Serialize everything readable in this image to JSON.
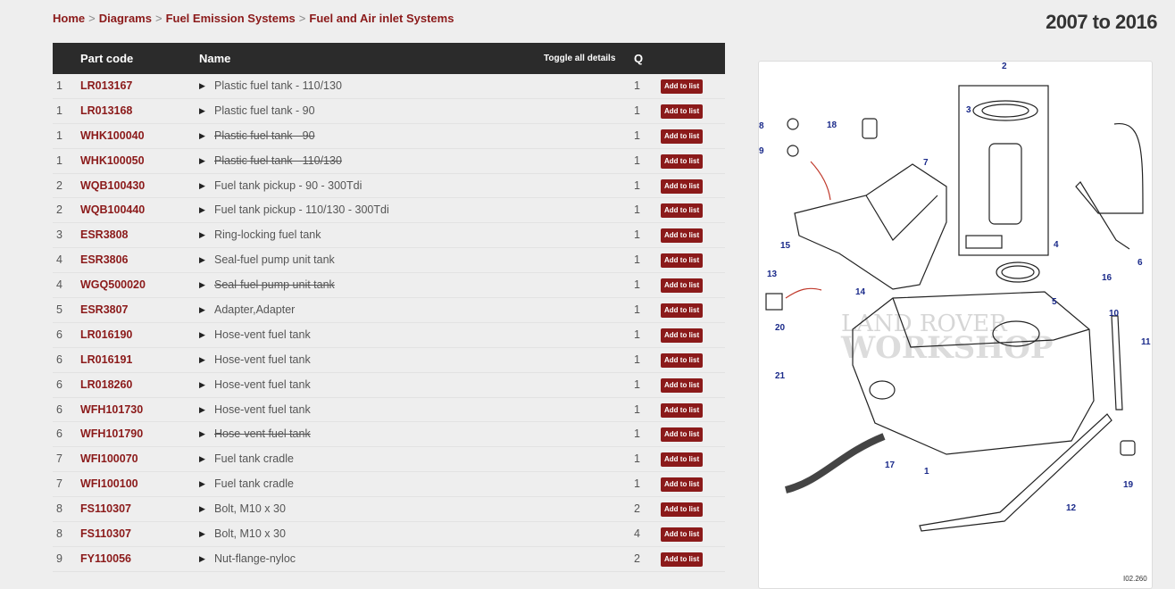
{
  "breadcrumb": [
    "Home",
    "Diagrams",
    "Fuel Emission Systems",
    "Fuel and Air inlet Systems"
  ],
  "year_range": "2007 to 2016",
  "table": {
    "headers": {
      "part_code": "Part code",
      "name": "Name",
      "toggle": "Toggle all details",
      "q": "Q"
    },
    "add_label": "Add to list",
    "rows": [
      {
        "num": "1",
        "code": "LR013167",
        "name": "Plastic fuel tank - 110/130",
        "q": "1",
        "struck": false
      },
      {
        "num": "1",
        "code": "LR013168",
        "name": "Plastic fuel tank - 90",
        "q": "1",
        "struck": false
      },
      {
        "num": "1",
        "code": "WHK100040",
        "name": "Plastic fuel tank - 90",
        "q": "1",
        "struck": true
      },
      {
        "num": "1",
        "code": "WHK100050",
        "name": "Plastic fuel tank - 110/130",
        "q": "1",
        "struck": true
      },
      {
        "num": "2",
        "code": "WQB100430",
        "name": "Fuel tank pickup - 90 - 300Tdi",
        "q": "1",
        "struck": false
      },
      {
        "num": "2",
        "code": "WQB100440",
        "name": "Fuel tank pickup - 110/130 - 300Tdi",
        "q": "1",
        "struck": false
      },
      {
        "num": "3",
        "code": "ESR3808",
        "name": "Ring-locking fuel tank",
        "q": "1",
        "struck": false
      },
      {
        "num": "4",
        "code": "ESR3806",
        "name": "Seal-fuel pump unit tank",
        "q": "1",
        "struck": false
      },
      {
        "num": "4",
        "code": "WGQ500020",
        "name": "Seal-fuel pump unit tank",
        "q": "1",
        "struck": true
      },
      {
        "num": "5",
        "code": "ESR3807",
        "name": "Adapter,Adapter",
        "q": "1",
        "struck": false
      },
      {
        "num": "6",
        "code": "LR016190",
        "name": "Hose-vent fuel tank",
        "q": "1",
        "struck": false
      },
      {
        "num": "6",
        "code": "LR016191",
        "name": "Hose-vent fuel tank",
        "q": "1",
        "struck": false
      },
      {
        "num": "6",
        "code": "LR018260",
        "name": "Hose-vent fuel tank",
        "q": "1",
        "struck": false
      },
      {
        "num": "6",
        "code": "WFH101730",
        "name": "Hose-vent fuel tank",
        "q": "1",
        "struck": false
      },
      {
        "num": "6",
        "code": "WFH101790",
        "name": "Hose-vent fuel tank",
        "q": "1",
        "struck": true
      },
      {
        "num": "7",
        "code": "WFI100070",
        "name": "Fuel tank cradle",
        "q": "1",
        "struck": false
      },
      {
        "num": "7",
        "code": "WFI100100",
        "name": "Fuel tank cradle",
        "q": "1",
        "struck": false
      },
      {
        "num": "8",
        "code": "FS110307",
        "name": "Bolt, M10 x 30",
        "q": "2",
        "struck": false
      },
      {
        "num": "8",
        "code": "FS110307",
        "name": "Bolt, M10 x 30",
        "q": "4",
        "struck": false
      },
      {
        "num": "9",
        "code": "FY110056",
        "name": "Nut-flange-nyloc",
        "q": "2",
        "struck": false
      }
    ]
  },
  "diagram": {
    "callouts": [
      "1",
      "2",
      "3",
      "4",
      "5",
      "6",
      "7",
      "8",
      "9",
      "10",
      "11",
      "12",
      "13",
      "14",
      "15",
      "16",
      "17",
      "18",
      "19",
      "20",
      "21"
    ],
    "watermark_line1": "LAND ROVER",
    "watermark_line2": "WORKSHOP",
    "ref": "I02.260"
  },
  "colors": {
    "accent": "#8b1a1a",
    "header_bg": "#2b2b2b",
    "callout": "#1a2a8a"
  }
}
